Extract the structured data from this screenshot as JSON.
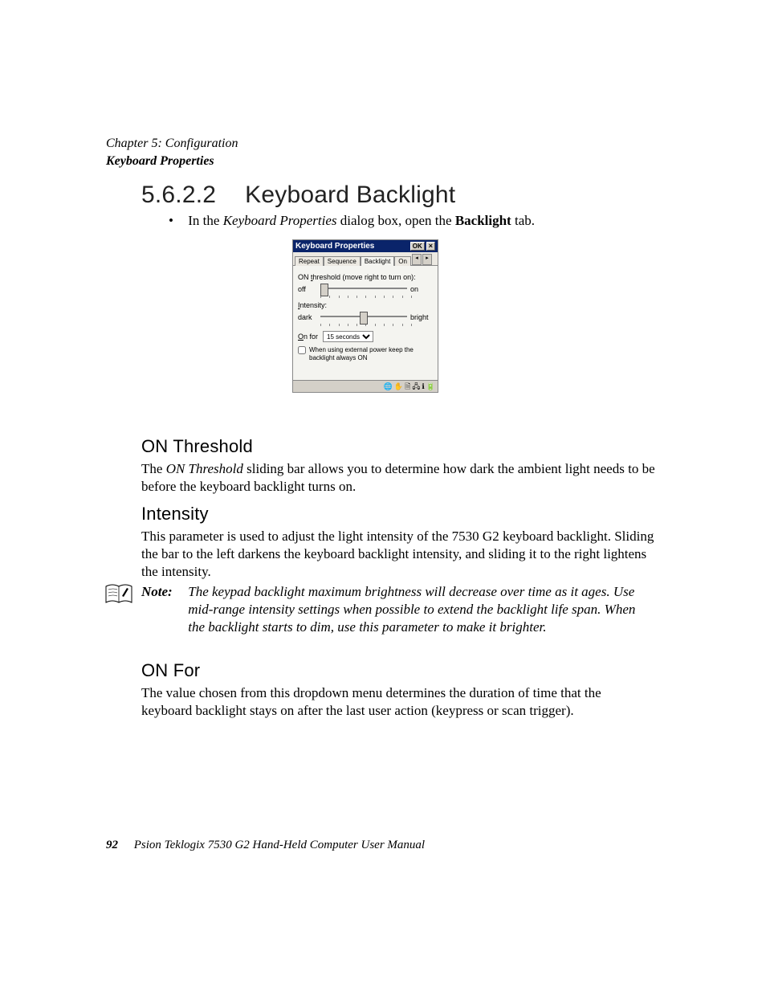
{
  "header": {
    "chapter": "Chapter 5: Configuration",
    "section": "Keyboard Properties"
  },
  "h1": {
    "number": "5.6.2.2",
    "title": "Keyboard Backlight"
  },
  "bullet": {
    "pre": "In the ",
    "italic1": "Keyboard Properties",
    "mid": " dialog box, open the ",
    "bold": "Backlight",
    "post": " tab."
  },
  "dialog": {
    "title": "Keyboard Properties",
    "ok": "OK",
    "close": "×",
    "tabs": {
      "repeat": "Repeat",
      "sequence": "Sequence",
      "backlight": "Backlight",
      "one": "On"
    },
    "threshold_label": "ON threshold (move right to turn on):",
    "off": "off",
    "on": "on",
    "intensity_label": "Intensity:",
    "dark": "dark",
    "bright": "bright",
    "onfor_label": "On for",
    "onfor_value": "15 seconds",
    "checkbox": "When using external power keep the backlight always ON"
  },
  "onthreshold": {
    "heading": "ON Threshold",
    "pre": "The ",
    "italic": "ON Threshold",
    "rest": " sliding bar allows you to determine how dark the ambient light needs to be before the keyboard backlight turns on."
  },
  "intensity": {
    "heading": "Intensity",
    "body": "This parameter is used to adjust the light intensity of the 7530 G2 keyboard backlight. Sliding the bar to the left darkens the keyboard backlight intensity, and sliding it to the right lightens the intensity."
  },
  "note": {
    "label": "Note:",
    "body": "The keypad backlight maximum brightness will decrease over time as it ages. Use mid-range intensity settings when possible to extend the backlight life span. When the backlight starts to dim, use this parameter to make it brighter."
  },
  "onfor": {
    "heading": "ON For",
    "body": "The value chosen from this dropdown menu determines the duration of time that the keyboard backlight stays on after the last user action (keypress or scan trigger)."
  },
  "footer": {
    "page": "92",
    "book": "Psion Teklogix 7530 G2 Hand-Held Computer User Manual"
  }
}
